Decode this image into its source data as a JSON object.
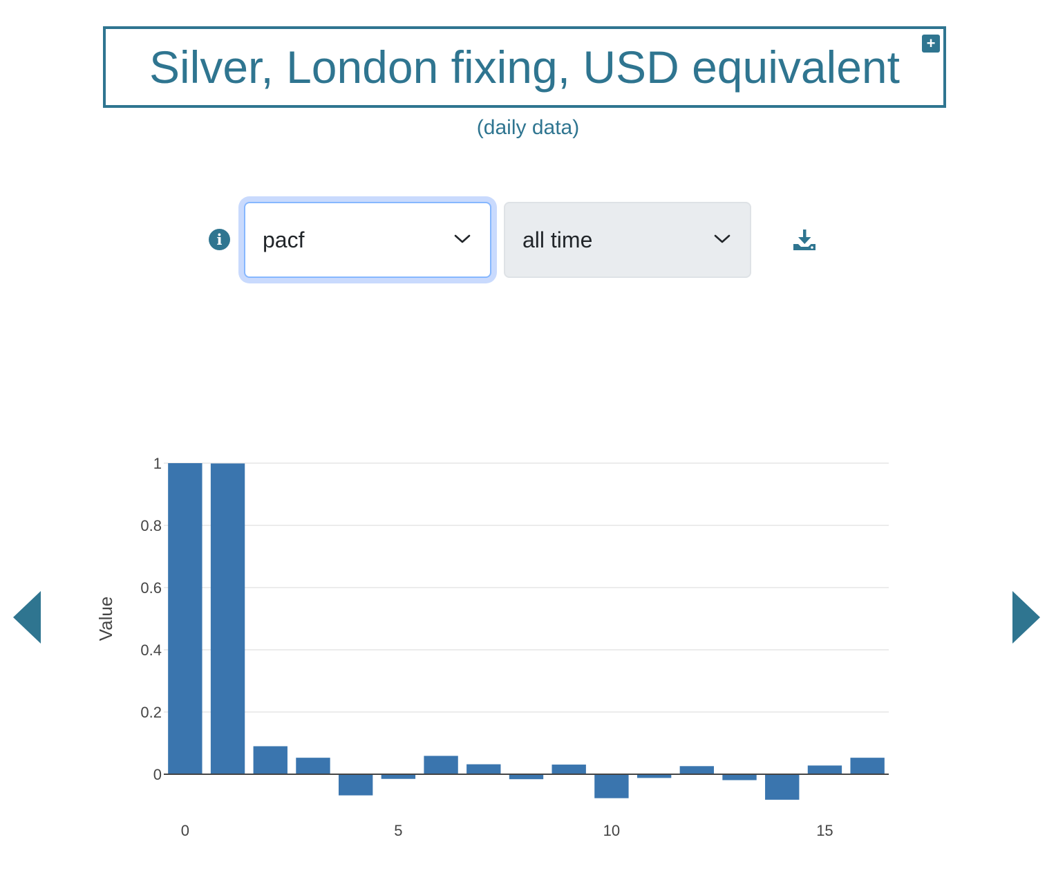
{
  "header": {
    "title": "Silver, London fixing, USD equivalent",
    "subtitle": "(daily data)",
    "expand_symbol": "+"
  },
  "controls": {
    "info_icon": "info-circle-icon",
    "metric_select": {
      "value": "pacf"
    },
    "range_select": {
      "value": "all time"
    },
    "download_icon": "download-icon"
  },
  "navigation": {
    "prev_icon": "caret-left-icon",
    "next_icon": "caret-right-icon"
  },
  "colors": {
    "accent": "#2f7590",
    "bar": "#3a75ae",
    "grid": "#e6e6e6"
  },
  "chart_data": {
    "type": "bar",
    "x": [
      0,
      1,
      2,
      3,
      4,
      5,
      6,
      7,
      8,
      9,
      10,
      11,
      12,
      13,
      14,
      15,
      16
    ],
    "values": [
      1.0,
      0.999,
      0.09,
      0.053,
      -0.068,
      -0.015,
      0.059,
      0.032,
      -0.016,
      0.031,
      -0.077,
      -0.012,
      0.026,
      -0.019,
      -0.082,
      0.028,
      0.053
    ],
    "ylabel": "Value",
    "xlabel": "",
    "xlim": [
      -0.5,
      16.5
    ],
    "ylim": [
      -0.1,
      1
    ],
    "xticks": [
      0,
      5,
      10,
      15
    ],
    "yticks": [
      0,
      0.2,
      0.4,
      0.6,
      0.8,
      1
    ],
    "ytick_labels": [
      "0",
      "0.2",
      "0.4",
      "0.6",
      "0.8",
      "1"
    ],
    "grid": true
  }
}
